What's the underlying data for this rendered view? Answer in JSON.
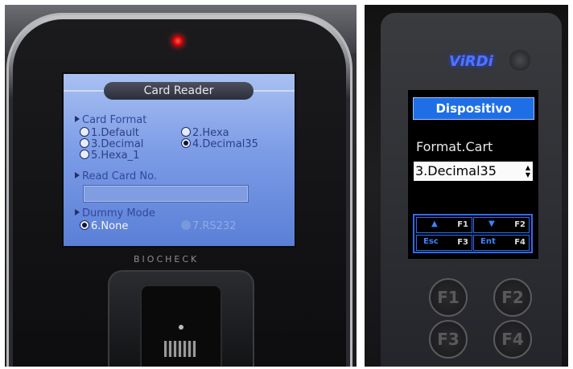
{
  "left_device": {
    "screen_title": "Card Reader",
    "card_format": {
      "heading": "Card Format",
      "options": [
        {
          "label": "1.Default",
          "selected": false
        },
        {
          "label": "2.Hexa",
          "selected": false
        },
        {
          "label": "3.Decimal",
          "selected": false
        },
        {
          "label": "4.Decimal35",
          "selected": true
        },
        {
          "label": "5.Hexa_1",
          "selected": false
        }
      ]
    },
    "read_card": {
      "heading": "Read Card No.",
      "value": ""
    },
    "dummy_mode": {
      "heading": "Dummy Mode",
      "options": [
        {
          "label": "6.None",
          "selected": true
        },
        {
          "label": "7.RS232",
          "selected": false
        }
      ]
    },
    "brand": "BIOCHECK",
    "led_color": "#e00000"
  },
  "right_device": {
    "logo": "ViRDi",
    "header": "Dispositivo",
    "setting_label": "Format.Cart",
    "setting_value": "3.Decimal35",
    "keys": [
      {
        "symbol": "▲",
        "fn": "F1"
      },
      {
        "symbol": "▼",
        "fn": "F2"
      },
      {
        "symbol": "Esc",
        "fn": "F3"
      },
      {
        "symbol": "Ent",
        "fn": "F4"
      }
    ],
    "hardware_buttons": [
      "F1",
      "F2",
      "F3",
      "F4"
    ],
    "accent_color": "#1e6fe6"
  }
}
